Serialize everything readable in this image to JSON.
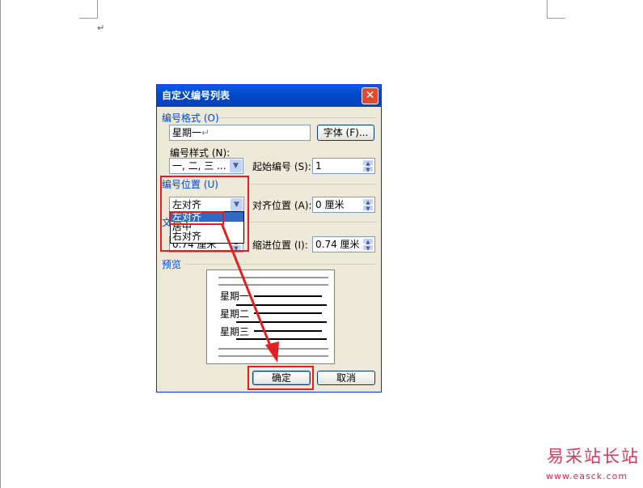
{
  "dialog": {
    "title": "自定义编号列表",
    "close_glyph": "✕",
    "number_format": {
      "group_label": "编号格式 (O)",
      "value": "星期一",
      "font_button": "字体 (F)..."
    },
    "number_style": {
      "label": "编号样式 (N):",
      "value": "一, 二, 三 ...",
      "start_label": "起始编号 (S):",
      "start_value": "1"
    },
    "number_position": {
      "group_label": "编号位置 (U)",
      "value": "左对齐",
      "align_label": "对齐位置 (A):",
      "align_value": "0 厘米",
      "options": [
        "左对齐",
        "居中",
        "右对齐"
      ],
      "selected": "左对齐"
    },
    "text_position": {
      "group_label": "文",
      "indent_value_partial": "0.74 厘米",
      "indent_label": "缩进位置 (I):",
      "indent_value": "0.74 厘米"
    },
    "preview": {
      "label": "预览",
      "items": [
        "星期一",
        "星期二",
        "星期三"
      ]
    },
    "ok_button": "确定",
    "cancel_button": "取消"
  },
  "document": {
    "paragraph_mark": "↵"
  },
  "watermark": {
    "text": "易采站长站",
    "url": "www.easck.com"
  },
  "colors": {
    "annotation": "#e02020",
    "title_bar": "#0a5de6",
    "dialog_bg": "#ece9d8"
  }
}
